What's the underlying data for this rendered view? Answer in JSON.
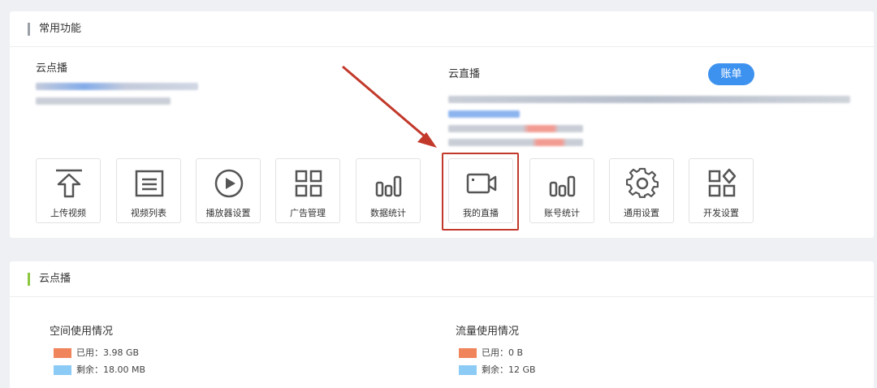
{
  "common": {
    "header_title": "常用功能",
    "header_bar_color": "#9aa0a6",
    "vod_title": "云点播",
    "live_title": "云直播",
    "account_button": "账单",
    "tools": [
      {
        "label": "上传视频",
        "icon": "upload-icon"
      },
      {
        "label": "视频列表",
        "icon": "video-list-icon"
      },
      {
        "label": "播放器设置",
        "icon": "player-icon"
      },
      {
        "label": "广告管理",
        "icon": "grid-icon"
      },
      {
        "label": "数据统计",
        "icon": "bar-chart-icon"
      },
      {
        "label": "我的直播",
        "icon": "camera-icon"
      },
      {
        "label": "账号统计",
        "icon": "account-stats-icon"
      },
      {
        "label": "通用设置",
        "icon": "gear-icon"
      },
      {
        "label": "开发设置",
        "icon": "dev-settings-icon"
      }
    ]
  },
  "vod": {
    "header_title": "云点播",
    "header_bar_color": "#8dc63f",
    "space": {
      "title": "空间使用情况",
      "used": "已用：3.98 GB",
      "remaining": "剩余：18.00 MB"
    },
    "traffic": {
      "title": "流量使用情况",
      "used": "已用：0 B",
      "remaining": "剩余：12 GB"
    },
    "colors": {
      "used": "#f0845a",
      "remaining": "#8ccbf5"
    }
  }
}
